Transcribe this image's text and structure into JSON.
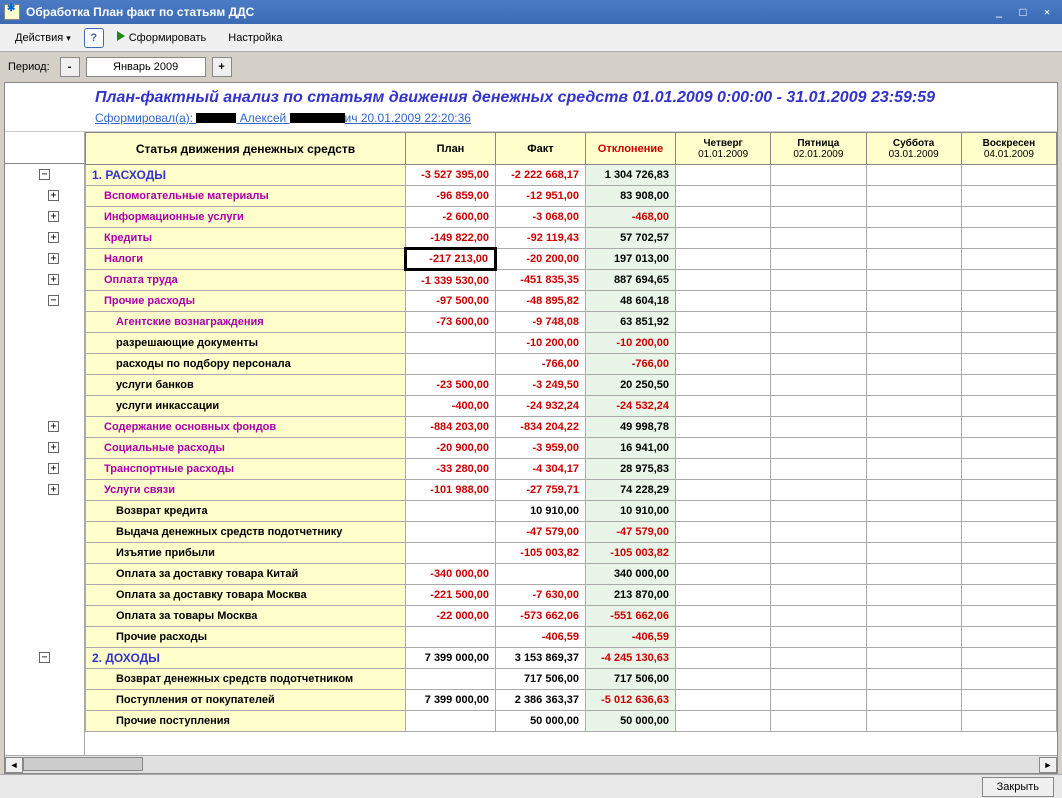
{
  "window": {
    "title": "Обработка  План факт по статьям ДДС"
  },
  "toolbar": {
    "actions": "Действия",
    "form": "Сформировать",
    "settings": "Настройка"
  },
  "period": {
    "label": "Период:",
    "value": "Январь 2009"
  },
  "report": {
    "title": "План-фактный анализ по статьям движения денежных средств  01.01.2009 0:00:00  -  31.01.2009 23:59:59",
    "formedBy": "Сформировал(а): ",
    "formedName": " Алексей ",
    "formedSuffix": "ич 20.01.2009 22:20:36"
  },
  "headers": {
    "article": "Статья движения денежных средств",
    "plan": "План",
    "fact": "Факт",
    "dev": "Отклонение",
    "days": [
      {
        "name": "Четверг",
        "date": "01.01.2009"
      },
      {
        "name": "Пятница",
        "date": "02.01.2009"
      },
      {
        "name": "Суббота",
        "date": "03.01.2009"
      },
      {
        "name": "Воскресен",
        "date": "04.01.2009"
      }
    ]
  },
  "rows": [
    {
      "lvl": 0,
      "name": "1. РАСХОДЫ",
      "cls": "top",
      "plan": "-3 527 395,00",
      "planNeg": true,
      "fact": "-2 222 668,17",
      "factNeg": true,
      "dev": "1 304 726,83",
      "devNeg": false,
      "exp": "−"
    },
    {
      "lvl": 1,
      "name": "Вспомогательные материалы",
      "cls": "sub1",
      "plan": "-96 859,00",
      "planNeg": true,
      "fact": "-12 951,00",
      "factNeg": true,
      "dev": "83 908,00",
      "devNeg": false,
      "exp": "+"
    },
    {
      "lvl": 1,
      "name": "Информационные услуги",
      "cls": "sub1",
      "plan": "-2 600,00",
      "planNeg": true,
      "fact": "-3 068,00",
      "factNeg": true,
      "dev": "-468,00",
      "devNeg": true,
      "exp": "+"
    },
    {
      "lvl": 1,
      "name": "Кредиты",
      "cls": "sub1",
      "plan": "-149 822,00",
      "planNeg": true,
      "fact": "-92 119,43",
      "factNeg": true,
      "dev": "57 702,57",
      "devNeg": false,
      "exp": "+"
    },
    {
      "lvl": 1,
      "name": "Налоги",
      "cls": "sub1",
      "plan": "-217 213,00",
      "planNeg": true,
      "planSel": true,
      "fact": "-20 200,00",
      "factNeg": true,
      "dev": "197 013,00",
      "devNeg": false,
      "exp": "+"
    },
    {
      "lvl": 1,
      "name": "Оплата труда",
      "cls": "sub1",
      "plan": "-1 339 530,00",
      "planNeg": true,
      "fact": "-451 835,35",
      "factNeg": true,
      "dev": "887 694,65",
      "devNeg": false,
      "exp": "+"
    },
    {
      "lvl": 1,
      "name": "Прочие расходы",
      "cls": "sub1",
      "plan": "-97 500,00",
      "planNeg": true,
      "fact": "-48 895,82",
      "factNeg": true,
      "dev": "48 604,18",
      "devNeg": false,
      "exp": "−"
    },
    {
      "lvl": 2,
      "name": "Агентские вознаграждения",
      "cls": "sub2l",
      "plan": "-73 600,00",
      "planNeg": true,
      "fact": "-9 748,08",
      "factNeg": true,
      "dev": "63 851,92",
      "devNeg": false
    },
    {
      "lvl": 2,
      "name": "разрешающие документы",
      "cls": "sub2",
      "plan": "",
      "fact": "-10 200,00",
      "factNeg": true,
      "dev": "-10 200,00",
      "devNeg": true
    },
    {
      "lvl": 2,
      "name": "расходы по подбору персонала",
      "cls": "sub2",
      "plan": "",
      "fact": "-766,00",
      "factNeg": true,
      "dev": "-766,00",
      "devNeg": true
    },
    {
      "lvl": 2,
      "name": "услуги банков",
      "cls": "sub2",
      "plan": "-23 500,00",
      "planNeg": true,
      "fact": "-3 249,50",
      "factNeg": true,
      "dev": "20 250,50",
      "devNeg": false
    },
    {
      "lvl": 2,
      "name": "услуги инкассации",
      "cls": "sub2",
      "plan": "-400,00",
      "planNeg": true,
      "fact": "-24 932,24",
      "factNeg": true,
      "dev": "-24 532,24",
      "devNeg": true
    },
    {
      "lvl": 1,
      "name": "Содержание основных фондов",
      "cls": "sub1",
      "plan": "-884 203,00",
      "planNeg": true,
      "fact": "-834 204,22",
      "factNeg": true,
      "dev": "49 998,78",
      "devNeg": false,
      "exp": "+"
    },
    {
      "lvl": 1,
      "name": "Социальные расходы",
      "cls": "sub1",
      "plan": "-20 900,00",
      "planNeg": true,
      "fact": "-3 959,00",
      "factNeg": true,
      "dev": "16 941,00",
      "devNeg": false,
      "exp": "+"
    },
    {
      "lvl": 1,
      "name": "Транспортные расходы",
      "cls": "sub1",
      "plan": "-33 280,00",
      "planNeg": true,
      "fact": "-4 304,17",
      "factNeg": true,
      "dev": "28 975,83",
      "devNeg": false,
      "exp": "+"
    },
    {
      "lvl": 1,
      "name": "Услуги связи",
      "cls": "sub1",
      "plan": "-101 988,00",
      "planNeg": true,
      "fact": "-27 759,71",
      "factNeg": true,
      "dev": "74 228,29",
      "devNeg": false,
      "exp": "+"
    },
    {
      "lvl": 1,
      "name": "Возврат кредита",
      "cls": "sub2p",
      "plan": "",
      "fact": "10 910,00",
      "factNeg": false,
      "dev": "10 910,00",
      "devNeg": false
    },
    {
      "lvl": 1,
      "name": "Выдача денежных средств подотчетнику",
      "cls": "sub2p",
      "plan": "",
      "fact": "-47 579,00",
      "factNeg": true,
      "dev": "-47 579,00",
      "devNeg": true
    },
    {
      "lvl": 1,
      "name": "Изъятие прибыли",
      "cls": "sub2p",
      "plan": "",
      "fact": "-105 003,82",
      "factNeg": true,
      "dev": "-105 003,82",
      "devNeg": true
    },
    {
      "lvl": 1,
      "name": "Оплата за доставку товара Китай",
      "cls": "sub2p",
      "plan": "-340 000,00",
      "planNeg": true,
      "fact": "",
      "dev": "340 000,00",
      "devNeg": false
    },
    {
      "lvl": 1,
      "name": "Оплата за доставку товара Москва",
      "cls": "sub2p",
      "plan": "-221 500,00",
      "planNeg": true,
      "fact": "-7 630,00",
      "factNeg": true,
      "dev": "213 870,00",
      "devNeg": false
    },
    {
      "lvl": 1,
      "name": "Оплата за товары Москва",
      "cls": "sub2p",
      "plan": "-22 000,00",
      "planNeg": true,
      "fact": "-573 662,06",
      "factNeg": true,
      "dev": "-551 662,06",
      "devNeg": true
    },
    {
      "lvl": 1,
      "name": "Прочие расходы",
      "cls": "sub2p",
      "plan": "",
      "fact": "-406,59",
      "factNeg": true,
      "dev": "-406,59",
      "devNeg": true
    },
    {
      "lvl": 0,
      "name": "2. ДОХОДЫ",
      "cls": "top",
      "plan": "7 399 000,00",
      "planNeg": false,
      "fact": "3 153 869,37",
      "factNeg": false,
      "dev": "-4 245 130,63",
      "devNeg": true,
      "exp": "−"
    },
    {
      "lvl": 1,
      "name": "Возврат денежных средств подотчетником",
      "cls": "sub2p",
      "plan": "",
      "fact": "717 506,00",
      "factNeg": false,
      "dev": "717 506,00",
      "devNeg": false
    },
    {
      "lvl": 1,
      "name": "Поступления от покупателей",
      "cls": "sub2p",
      "plan": "7 399 000,00",
      "planNeg": false,
      "fact": "2 386 363,37",
      "factNeg": false,
      "dev": "-5 012 636,63",
      "devNeg": true
    },
    {
      "lvl": 1,
      "name": "Прочие поступления",
      "cls": "sub2p",
      "plan": "",
      "fact": "50 000,00",
      "factNeg": false,
      "dev": "50 000,00",
      "devNeg": false
    }
  ],
  "footer": {
    "close": "Закрыть"
  }
}
